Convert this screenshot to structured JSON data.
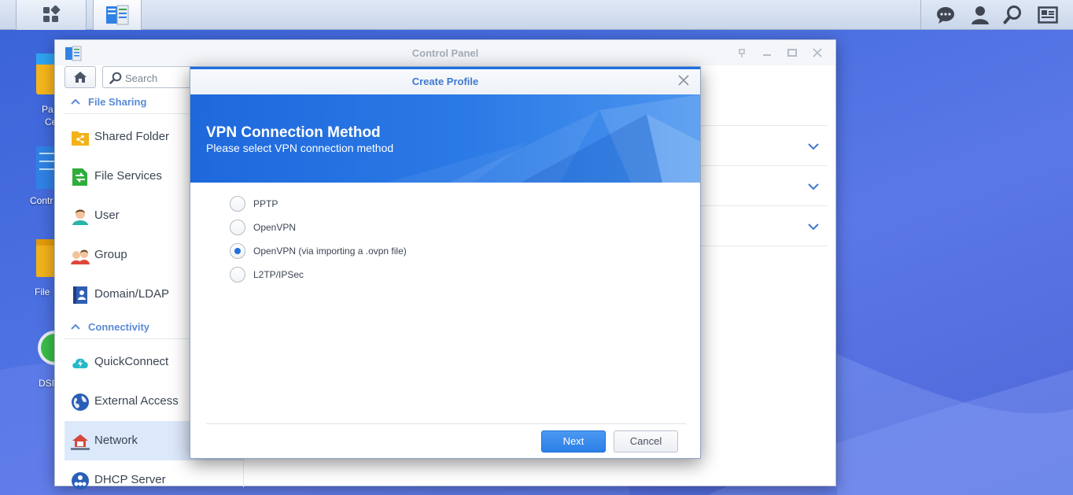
{
  "window": {
    "title": "Control Panel"
  },
  "search": {
    "placeholder": "Search"
  },
  "desktop": {
    "labels": [
      "Pa",
      "Ce",
      "Contr",
      "File",
      "DSI"
    ]
  },
  "sidebar": {
    "sections": [
      {
        "header": "File Sharing",
        "items": [
          {
            "label": "Shared Folder",
            "icon": "shared-folder-icon"
          },
          {
            "label": "File Services",
            "icon": "file-services-icon"
          },
          {
            "label": "User",
            "icon": "user-icon"
          },
          {
            "label": "Group",
            "icon": "group-icon"
          },
          {
            "label": "Domain/LDAP",
            "icon": "domain-ldap-icon"
          }
        ]
      },
      {
        "header": "Connectivity",
        "items": [
          {
            "label": "QuickConnect",
            "icon": "quickconnect-icon"
          },
          {
            "label": "External Access",
            "icon": "external-access-icon"
          },
          {
            "label": "Network",
            "icon": "network-icon",
            "active": true
          },
          {
            "label": "DHCP Server",
            "icon": "dhcp-server-icon"
          }
        ]
      }
    ]
  },
  "dialog": {
    "title": "Create Profile",
    "banner_title": "VPN Connection Method",
    "banner_subtitle": "Please select VPN connection method",
    "options": [
      {
        "label": "PPTP",
        "selected": false
      },
      {
        "label": "OpenVPN",
        "selected": false
      },
      {
        "label": "OpenVPN (via importing a .ovpn file)",
        "selected": true
      },
      {
        "label": "L2TP/IPSec",
        "selected": false
      }
    ],
    "next_label": "Next",
    "cancel_label": "Cancel"
  },
  "colors": {
    "accent": "#2a7ee6",
    "desktop": "#4a6fe0",
    "section_header": "#5a8ad6",
    "active_item": "#dce9fb"
  }
}
